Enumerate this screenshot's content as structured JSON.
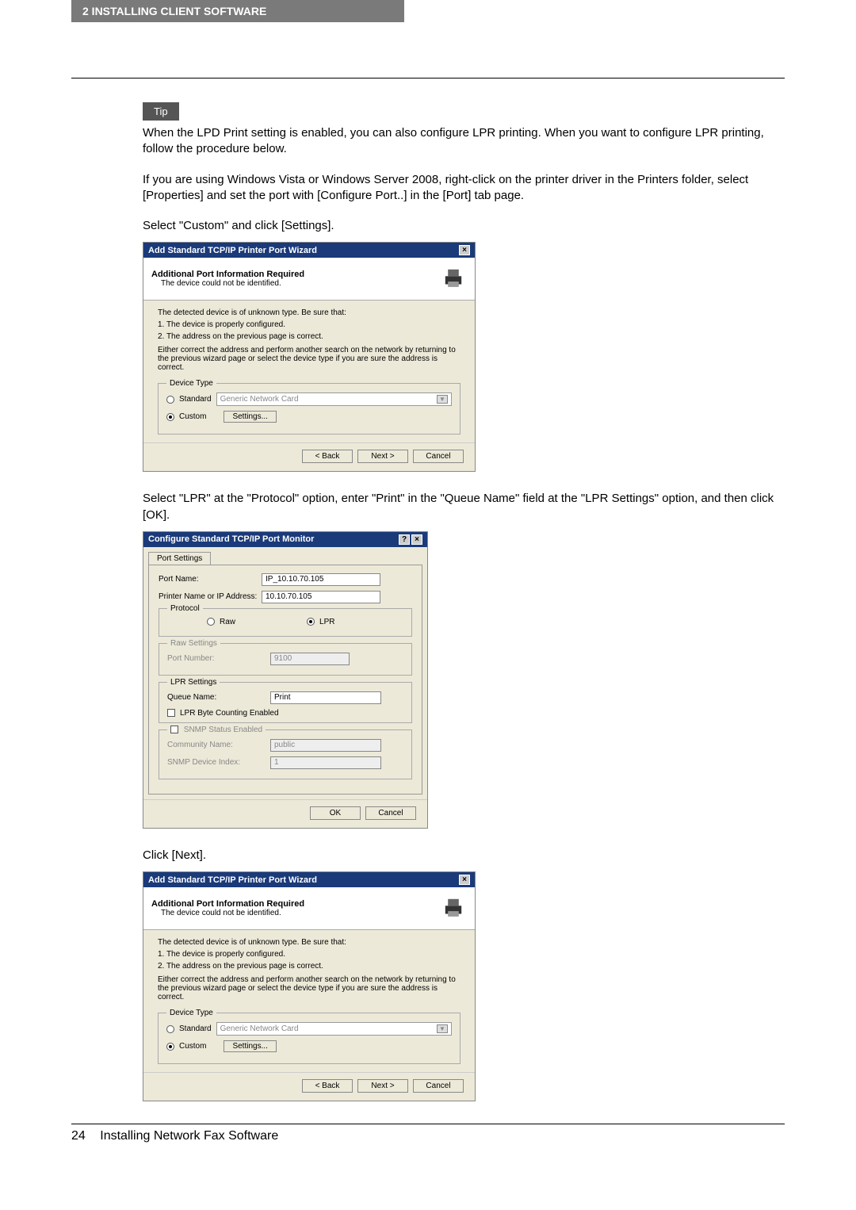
{
  "header": {
    "chapter": "2  INSTALLING CLIENT SOFTWARE"
  },
  "tip_label": "Tip",
  "intro": {
    "p1": "When the LPD Print setting is enabled, you can also configure LPR printing. When you want to configure LPR printing, follow the procedure below.",
    "p2": "If you are using Windows Vista or Windows Server 2008, right-click on the printer driver in the Printers folder, select [Properties] and set the port with [Configure Port..] in the [Port] tab page."
  },
  "step1": "Select \"Custom\" and click [Settings].",
  "wizard": {
    "title": "Add Standard TCP/IP Printer Port Wizard",
    "heading": "Additional Port Information Required",
    "subheading": "The device could not be identified.",
    "info": {
      "l1": "The detected device is of unknown type.  Be sure that:",
      "l2": "1.  The device is properly configured.",
      "l3": "2.  The address on the previous page is correct.",
      "l4": "Either correct the address and perform another search on the network by returning to the previous wizard page or select the device type if you are sure the address is correct."
    },
    "deviceTypeLegend": "Device Type",
    "standardLabel": "Standard",
    "standardSelect": "Generic Network Card",
    "customLabel": "Custom",
    "settingsBtn": "Settings...",
    "back": "< Back",
    "next": "Next >",
    "cancel": "Cancel"
  },
  "step2": "Select \"LPR\" at the \"Protocol\" option, enter \"Print\" in the \"Queue Name\" field at the \"LPR Settings\" option, and then click [OK].",
  "portmon": {
    "title": "Configure Standard TCP/IP Port Monitor",
    "tab": "Port Settings",
    "portNameLabel": "Port Name:",
    "portNameValue": "IP_10.10.70.105",
    "ipLabel": "Printer Name or IP Address:",
    "ipValue": "10.10.70.105",
    "protocolLegend": "Protocol",
    "rawLabel": "Raw",
    "lprLabel": "LPR",
    "rawLegend": "Raw Settings",
    "rawPortLabel": "Port Number:",
    "rawPortValue": "9100",
    "lprLegend": "LPR Settings",
    "queueLabel": "Queue Name:",
    "queueValue": "Print",
    "byteCount": "LPR Byte Counting Enabled",
    "snmpLegend": "SNMP Status Enabled",
    "community": "Community Name:",
    "communityVal": "public",
    "snmpIndex": "SNMP Device Index:",
    "snmpIndexVal": "1",
    "ok": "OK",
    "cancel": "Cancel"
  },
  "step3": "Click [Next].",
  "footer": {
    "page": "24",
    "title": "Installing Network Fax Software"
  }
}
